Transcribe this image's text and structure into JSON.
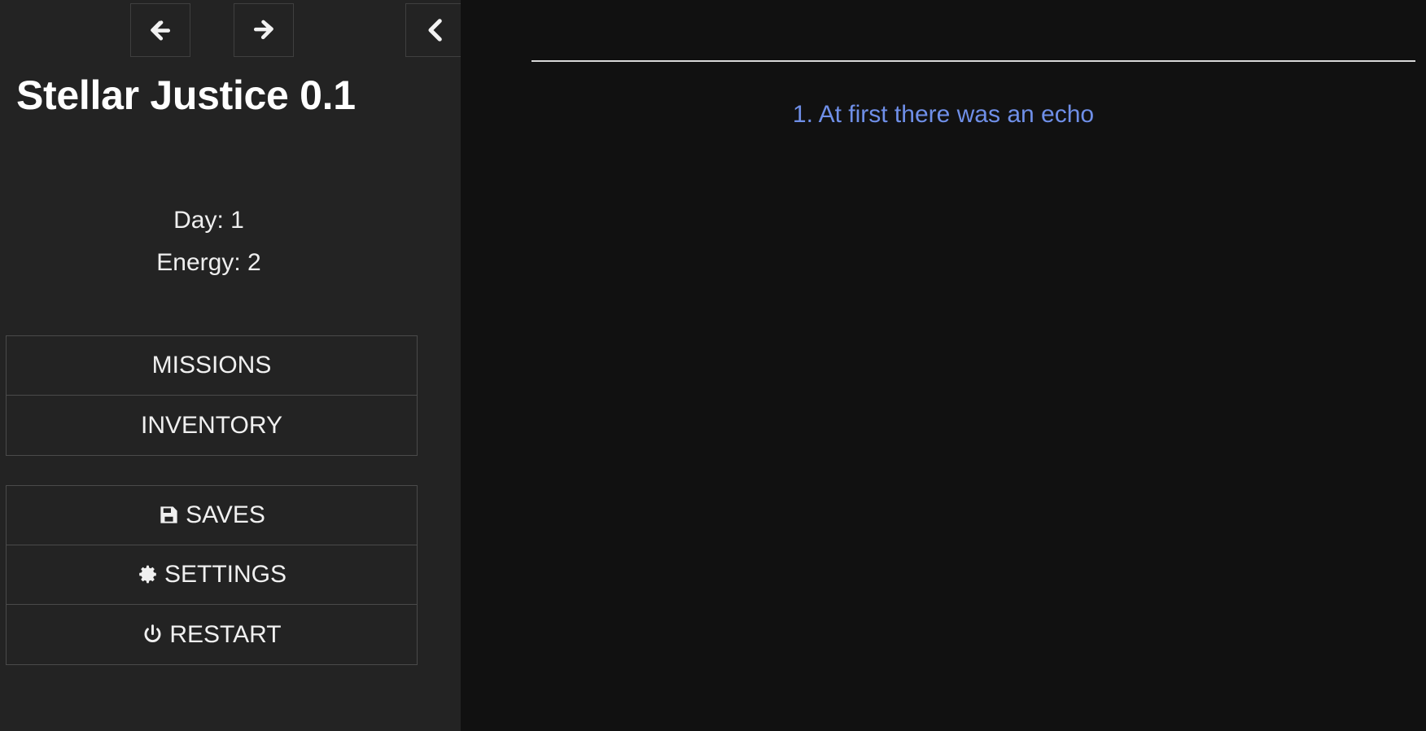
{
  "sidebar": {
    "nav": {
      "back_label": "Back",
      "back_icon": "arrow-left-icon",
      "forward_label": "Forward",
      "forward_icon": "arrow-right-icon",
      "collapse_label": "Collapse sidebar",
      "collapse_icon": "chevron-left-icon"
    },
    "title": "Stellar Justice 0.1",
    "stats": {
      "day": "Day: 1",
      "energy": "Energy: 2"
    },
    "primary_buttons": [
      {
        "label": "MISSIONS",
        "icon": ""
      },
      {
        "label": "INVENTORY",
        "icon": ""
      }
    ],
    "secondary_buttons": [
      {
        "label": "SAVES",
        "icon": "floppy-disk-icon"
      },
      {
        "label": "SETTINGS",
        "icon": "gear-icon"
      },
      {
        "label": "RESTART",
        "icon": "power-icon"
      }
    ]
  },
  "main": {
    "passage_link": "1. At first there was an echo"
  },
  "colors": {
    "sidebar_background": "#232323",
    "main_background": "#111111",
    "text": "#f0f0f0",
    "link": "#6f8fe8",
    "border": "#4a4a4a",
    "rule": "#d8d8d8"
  }
}
